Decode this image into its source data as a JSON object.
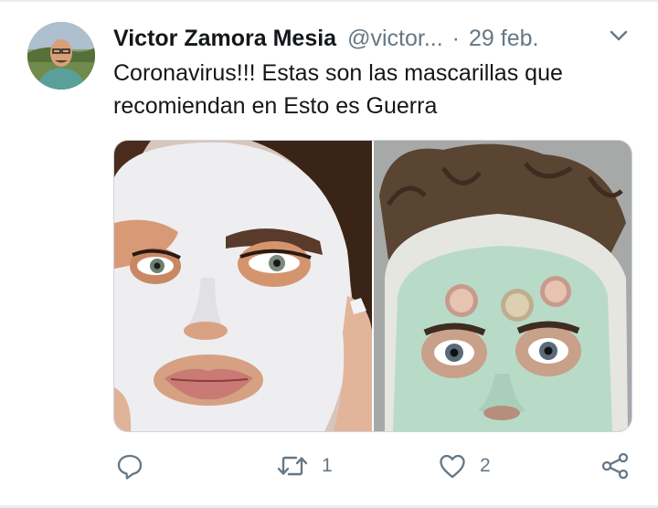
{
  "tweet": {
    "author": {
      "display_name": "Victor Zamora Mesia",
      "handle": "@victor...",
      "avatar": "profile-photo"
    },
    "separator": "·",
    "date": "29 feb.",
    "text": "Coronavirus!!! Estas son las mascarillas que recomiendan en Esto es Guerra",
    "media": {
      "images": [
        "woman-white-face-mask-photo",
        "man-green-face-mask-with-cucumber-slices-photo"
      ]
    },
    "actions": {
      "reply": {
        "icon": "reply-icon",
        "count": ""
      },
      "retweet": {
        "icon": "retweet-icon",
        "count": "1"
      },
      "like": {
        "icon": "heart-icon",
        "count": "2"
      },
      "share": {
        "icon": "share-icon"
      }
    },
    "menu_icon": "chevron-down-icon",
    "colors": {
      "text_primary": "#14171a",
      "text_secondary": "#657786",
      "border": "#ccd6dd"
    }
  }
}
